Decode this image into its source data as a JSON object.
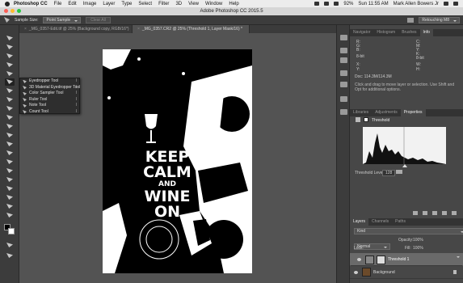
{
  "menubar": {
    "app": "Photoshop CC",
    "items": [
      "File",
      "Edit",
      "Image",
      "Layer",
      "Type",
      "Select",
      "Filter",
      "3D",
      "View",
      "Window",
      "Help"
    ],
    "status": {
      "battery": "92%",
      "clock": "Sun 11:55 AM",
      "user": "Mark Allen Bowers Jr"
    }
  },
  "window": {
    "title": "Adobe Photoshop CC 2015.5"
  },
  "options": {
    "sample_size_label": "Sample Size:",
    "sample_size_value": "Point Sample",
    "clear_all": "Clear All",
    "workspace": "Retouching M8"
  },
  "tabs": [
    {
      "label": "_MG_0357-Edit.tif @ 25% (Background copy, RGB/16*)",
      "active": false
    },
    {
      "label": "_MG_0357.CR2 @ 25% (Threshold 1, Layer Mask/16) *",
      "active": true
    }
  ],
  "flyout": {
    "items": [
      {
        "label": "Eyedropper Tool",
        "key": "I"
      },
      {
        "label": "3D Material Eyedropper Tool",
        "key": "I"
      },
      {
        "label": "Color Sampler Tool",
        "key": "I"
      },
      {
        "label": "Ruler Tool",
        "key": "I"
      },
      {
        "label": "Note Tool",
        "key": "I"
      },
      {
        "label": "Count Tool",
        "key": "I"
      }
    ]
  },
  "artwork": {
    "line1": "KEEP",
    "line2": "CALM",
    "line3": "AND",
    "line4": "WINE",
    "line5": "ON"
  },
  "info_panel": {
    "tabs": [
      "Navigator",
      "Histogram",
      "Brushes",
      "Info"
    ],
    "r": "R:",
    "g": "G:",
    "b": "B:",
    "bit_left": "8-bit",
    "bit_right": "8-bit",
    "x": "X:",
    "y": "Y:",
    "w": "W:",
    "h": "H:",
    "doc": "Doc: 114.3M/114.3M",
    "hint": "Click and drag to move layer or selection. Use Shift and Opt for additional options.",
    "c": "C:",
    "m": "M:",
    "yv": "Y:",
    "k": "K:"
  },
  "properties_panel": {
    "tabs": [
      "Libraries",
      "Adjustments",
      "Properties"
    ],
    "title": "Threshold",
    "threshold_label": "Threshold Level:",
    "threshold_value": "128"
  },
  "layers_panel": {
    "tabs": [
      "Layers",
      "Channels",
      "Paths"
    ],
    "kind": "Kind",
    "blend": "Normal",
    "opacity_label": "Opacity:",
    "opacity": "100%",
    "lock_label": "Lock:",
    "fill_label": "Fill:",
    "fill": "100%",
    "layers": [
      {
        "name": "Threshold 1",
        "selected": true
      },
      {
        "name": "Background",
        "selected": false
      }
    ]
  }
}
